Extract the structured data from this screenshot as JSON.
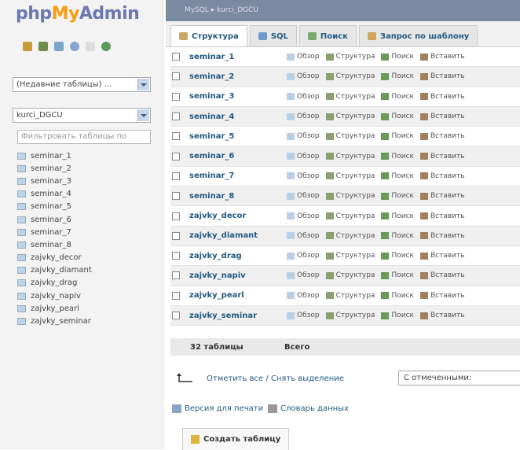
{
  "logo": {
    "php": "php",
    "my": "My",
    "admin": "Admin"
  },
  "left": {
    "recent_tables": "(Недавние таблицы) ...",
    "database": "kurci_DGCU",
    "filter_placeholder": "Фильтровать таблицы по",
    "tables": [
      "seminar_1",
      "seminar_2",
      "seminar_3",
      "seminar_4",
      "seminar_5",
      "seminar_6",
      "seminar_7",
      "seminar_8",
      "zajvky_decor",
      "zajvky_diamant",
      "zajvky_drag",
      "zajvky_napiv",
      "zajvky_pearl",
      "zajvky_seminar"
    ]
  },
  "breadcrumb": "MySQL ▸ kurci_DGCU",
  "tabs": [
    "Структура",
    "SQL",
    "Поиск",
    "Запрос по шаблону"
  ],
  "row_actions": [
    "Обзор",
    "Структура",
    "Поиск",
    "Вставить"
  ],
  "rows": [
    "seminar_1",
    "seminar_2",
    "seminar_3",
    "seminar_4",
    "seminar_5",
    "seminar_6",
    "seminar_7",
    "seminar_8",
    "zajvky_decor",
    "zajvky_diamant",
    "zajvky_drag",
    "zajvky_napiv",
    "zajvky_pearl",
    "zajvky_seminar"
  ],
  "summary": {
    "count": "32 таблицы",
    "total": "Всего"
  },
  "check_all": "Отметить все / Снять выделение",
  "with_selected": "С отмеченными:",
  "links": {
    "print": "Версия для печати",
    "dict": "Словарь данных"
  },
  "create_table": "Создать таблицу",
  "colors": {
    "accent": "#235a81",
    "logo_blue": "#6c78af",
    "logo_orange": "#f89c0e"
  }
}
